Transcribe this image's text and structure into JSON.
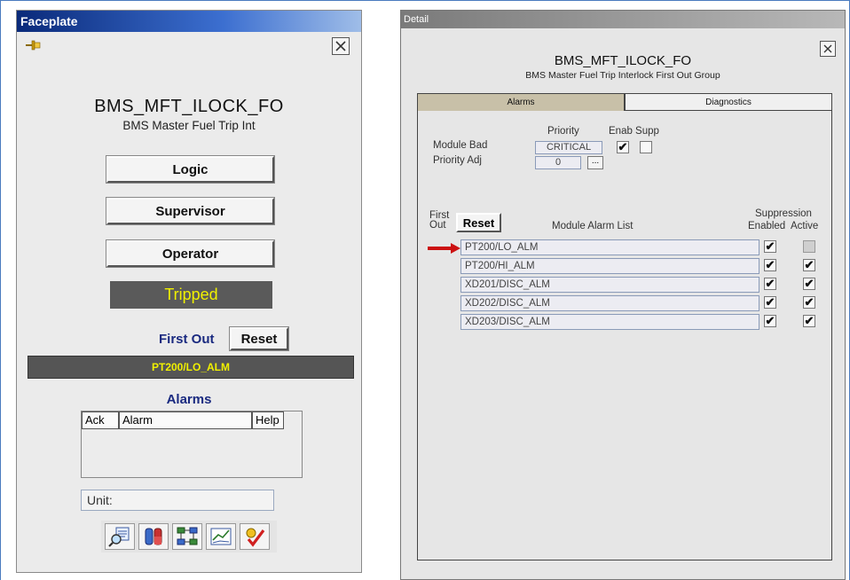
{
  "faceplate": {
    "window_title": "Faceplate",
    "tag": "BMS_MFT_ILOCK_FO",
    "description": "BMS Master Fuel Trip Int",
    "buttons": [
      "Logic",
      "Supervisor",
      "Operator"
    ],
    "state": "Tripped",
    "first_out_label": "First Out",
    "reset_label": "Reset",
    "first_out_value": "PT200/LO_ALM",
    "alarms_label": "Alarms",
    "alarm_columns": [
      "Ack",
      "Alarm",
      "Help"
    ],
    "unit_label": "Unit:",
    "toolbar_icons": [
      "trend-search-icon",
      "faceplate-icon",
      "detail-diagram-icon",
      "trend-chart-icon",
      "checkmark-icon"
    ],
    "colors": {
      "titlebar": "#0a2a7a",
      "state_text": "#f0f000",
      "label_blue": "#1a2a80"
    }
  },
  "detail": {
    "window_title": "Detail",
    "tag": "BMS_MFT_ILOCK_FO",
    "description": "BMS Master Fuel Trip Interlock First Out Group",
    "tabs": [
      "Alarms",
      "Diagnostics"
    ],
    "active_tab": "Alarms",
    "priority_header": "Priority",
    "enab_supp_header": "Enab Supp",
    "module_bad_label": "Module Bad",
    "module_bad_priority": "CRITICAL",
    "module_bad_enabled": true,
    "module_bad_supp": false,
    "priority_adj_label": "Priority Adj",
    "priority_adj_value": "0",
    "priority_adj_button": "...",
    "first_out_label_1": "First",
    "first_out_label_2": "Out",
    "reset_label": "Reset",
    "module_alarm_list_label": "Module Alarm List",
    "suppression_label": "Suppression",
    "enabled_label": "Enabled",
    "active_label": "Active",
    "alarms": [
      {
        "name": "PT200/LO_ALM",
        "enabled": true,
        "active": false,
        "first_out": true
      },
      {
        "name": "PT200/HI_ALM",
        "enabled": true,
        "active": true,
        "first_out": false
      },
      {
        "name": "XD201/DISC_ALM",
        "enabled": true,
        "active": true,
        "first_out": false
      },
      {
        "name": "XD202/DISC_ALM",
        "enabled": true,
        "active": true,
        "first_out": false
      },
      {
        "name": "XD203/DISC_ALM",
        "enabled": true,
        "active": true,
        "first_out": false
      }
    ],
    "colors": {
      "first_out_arrow": "#cc1111",
      "active_tab": "#c8c0a8"
    }
  }
}
